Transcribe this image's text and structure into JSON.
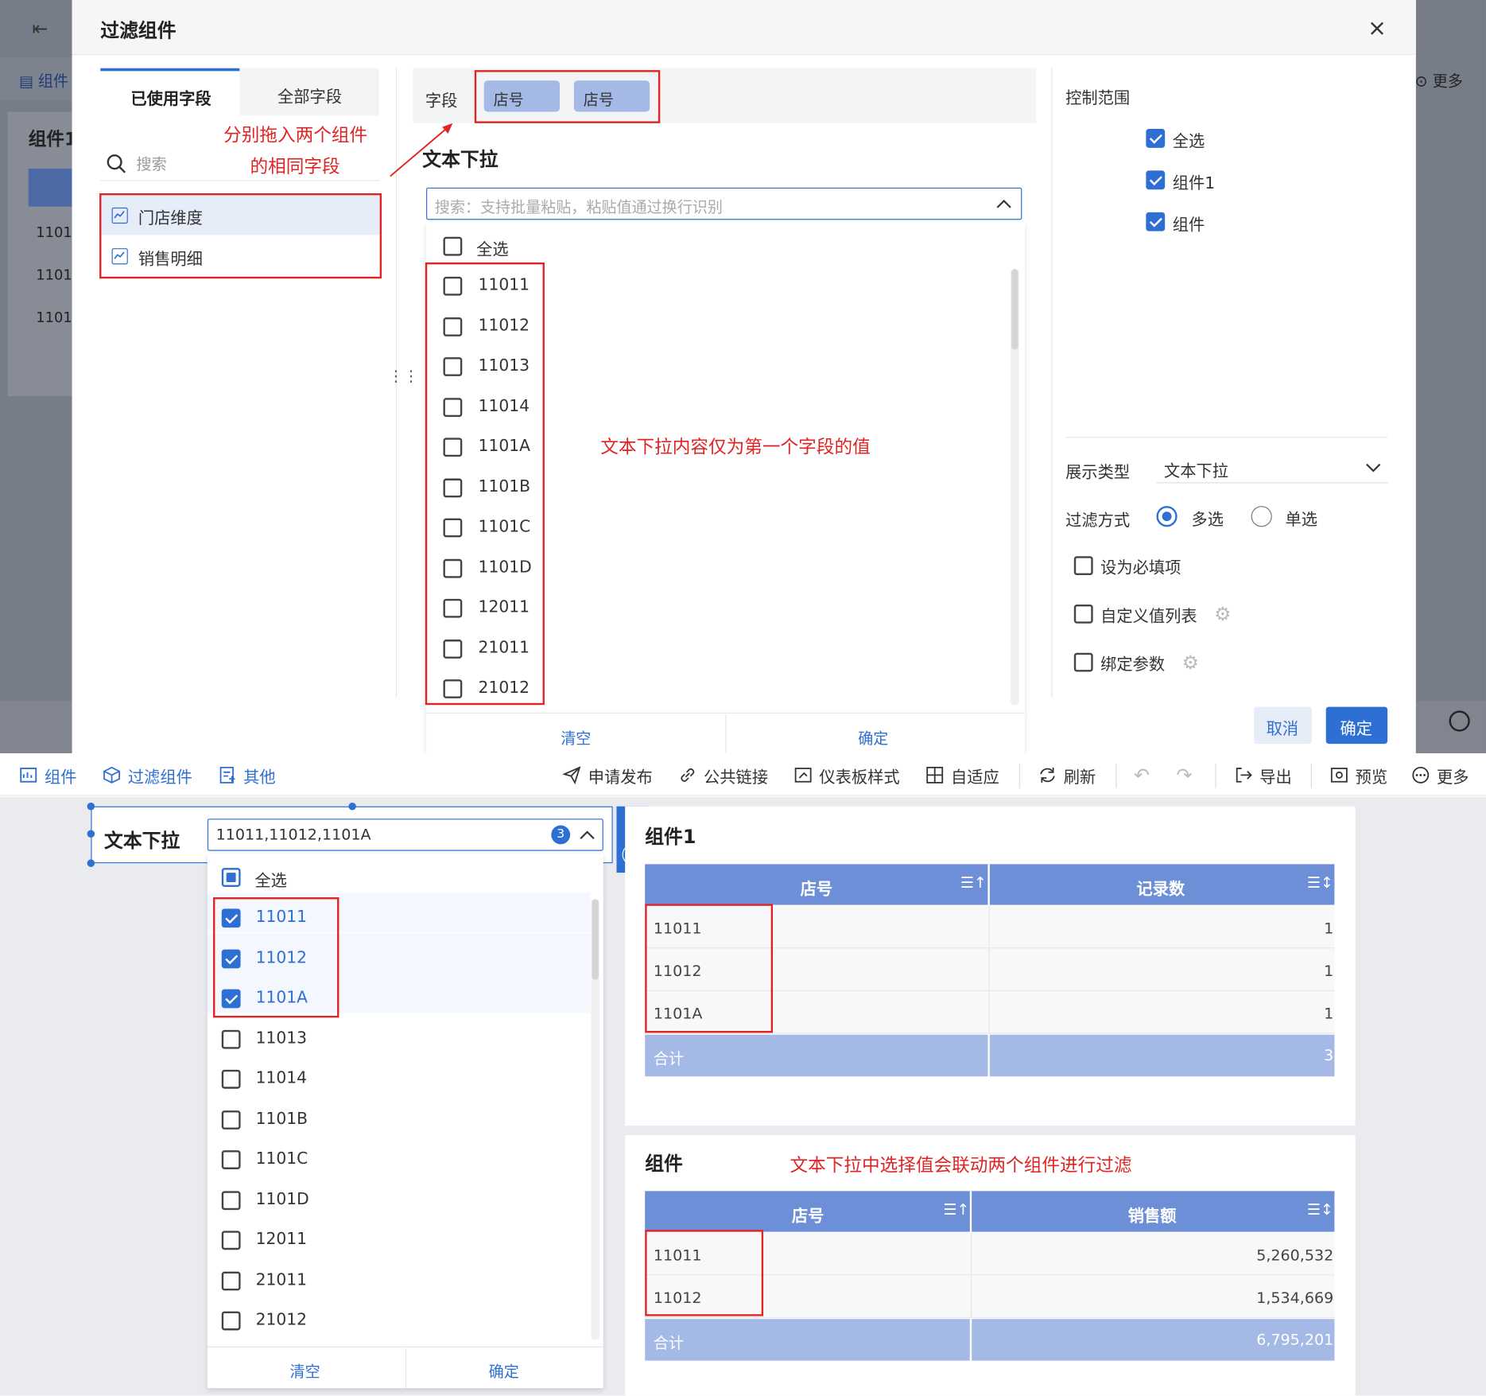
{
  "dialog": {
    "title": "过滤组件",
    "tabs": [
      "已使用字段",
      "全部字段"
    ],
    "search_placeholder": "搜索",
    "datasets": [
      "门店维度",
      "销售明细"
    ],
    "field_label": "字段",
    "field_chips": [
      "店号",
      "店号"
    ],
    "component_title": "文本下拉",
    "dropdown_placeholder": "搜索：支持批量粘贴，粘贴值通过换行识别",
    "select_all": "全选",
    "options": [
      "11011",
      "11012",
      "11013",
      "11014",
      "1101A",
      "1101B",
      "1101C",
      "1101D",
      "12011",
      "21011",
      "21012"
    ],
    "clear": "清空",
    "ok": "确定",
    "control_range_label": "控制范围",
    "control_range": [
      {
        "label": "全选",
        "checked": true
      },
      {
        "label": "组件1",
        "checked": true
      },
      {
        "label": "组件",
        "checked": true
      }
    ],
    "display_type_label": "展示类型",
    "display_type_value": "文本下拉",
    "filter_mode_label": "过滤方式",
    "filter_multi": "多选",
    "filter_single": "单选",
    "required_label": "设为必填项",
    "custom_list_label": "自定义值列表",
    "bind_param_label": "绑定参数",
    "cancel_button": "取消",
    "confirm_button": "确定"
  },
  "background": {
    "toolbar_item": "组件",
    "widget_title": "组件1",
    "rows": [
      "1101",
      "1101",
      "1101"
    ],
    "more": "更多"
  },
  "annotations": {
    "drag_hint_1": "分别拖入两个组件",
    "drag_hint_2": "的相同字段",
    "dropdown_note": "文本下拉内容仅为第一个字段的值",
    "linkage_note": "文本下拉中选择值会联动两个组件进行过滤"
  },
  "toolbar": {
    "left": [
      "组件",
      "过滤组件",
      "其他"
    ],
    "right": [
      "申请发布",
      "公共链接",
      "仪表板样式",
      "自适应",
      "刷新",
      "导出",
      "预览",
      "更多"
    ]
  },
  "filter_widget": {
    "title": "文本下拉",
    "value": "11011,11012,1101A",
    "count": "3",
    "select_all": "全选",
    "options": [
      {
        "label": "11011",
        "checked": true
      },
      {
        "label": "11012",
        "checked": true
      },
      {
        "label": "1101A",
        "checked": true
      },
      {
        "label": "11013",
        "checked": false
      },
      {
        "label": "11014",
        "checked": false
      },
      {
        "label": "1101B",
        "checked": false
      },
      {
        "label": "1101C",
        "checked": false
      },
      {
        "label": "1101D",
        "checked": false
      },
      {
        "label": "12011",
        "checked": false
      },
      {
        "label": "21011",
        "checked": false
      },
      {
        "label": "21012",
        "checked": false
      }
    ],
    "clear": "清空",
    "ok": "确定"
  },
  "table1": {
    "title": "组件1",
    "columns": [
      "店号",
      "记录数"
    ],
    "rows": [
      [
        "11011",
        "1"
      ],
      [
        "11012",
        "1"
      ],
      [
        "1101A",
        "1"
      ]
    ],
    "total": [
      "合计",
      "3"
    ]
  },
  "table2": {
    "title": "组件",
    "columns": [
      "店号",
      "销售额"
    ],
    "rows": [
      [
        "11011",
        "5,260,532"
      ],
      [
        "11012",
        "1,534,669"
      ]
    ],
    "total": [
      "合计",
      "6,795,201"
    ]
  },
  "colors": {
    "accent": "#2d6fd3",
    "header_blue": "#6c8fd8",
    "total_blue": "#a4b9e6",
    "annotation_red": "#e02424",
    "overlay": "#767c87"
  }
}
